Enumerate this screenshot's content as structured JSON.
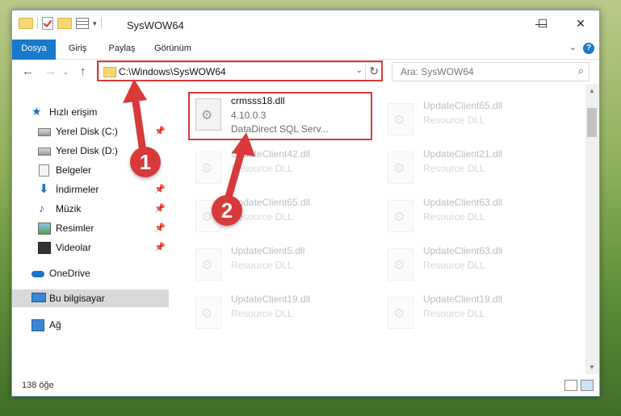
{
  "window": {
    "title": "SysWOW64",
    "controls": {
      "minimize": "—",
      "maximize": "☐",
      "close": "✕"
    }
  },
  "ribbon": {
    "tabs": [
      "Dosya",
      "Giriş",
      "Paylaş",
      "Görünüm"
    ],
    "expand_glyph": "⌄",
    "help_glyph": "?"
  },
  "address": {
    "path": "C:\\Windows\\SysWOW64",
    "back_glyph": "←",
    "forward_glyph": "→",
    "up_glyph": "↑",
    "dropdown_glyph": "⌄",
    "refresh_glyph": "↻"
  },
  "search": {
    "placeholder": "Ara: SysWOW64",
    "icon_glyph": "⌕"
  },
  "nav": {
    "quick_access": "Hızlı erişim",
    "items": [
      {
        "label": "Yerel Disk (C:)",
        "icon": "drive-icon"
      },
      {
        "label": "Yerel Disk (D:)",
        "icon": "drive-icon"
      },
      {
        "label": "Belgeler",
        "icon": "documents-icon"
      },
      {
        "label": "İndirmeler",
        "icon": "downloads-icon"
      },
      {
        "label": "Müzik",
        "icon": "music-icon"
      },
      {
        "label": "Resimler",
        "icon": "pictures-icon"
      },
      {
        "label": "Videolar",
        "icon": "videos-icon"
      }
    ],
    "pin_glyph": "📌",
    "onedrive": "OneDrive",
    "this_pc": "Bu bilgisayar",
    "network": "Ağ"
  },
  "files": {
    "highlighted": {
      "name": "crmsss18.dll",
      "version": "4.10.0.3",
      "description": "DataDirect SQL Serv..."
    },
    "ghost_items": [
      {
        "name": "UpdateClient65.dll",
        "description": "Resource DLL"
      },
      {
        "name": "UpdateClient42.dll",
        "description": "Resource DLL"
      },
      {
        "name": "UpdateClient21.dll",
        "description": "Resource DLL"
      },
      {
        "name": "UpdateClient65.dll",
        "description": "Resource DLL"
      },
      {
        "name": "UpdateClient63.dll",
        "description": "Resource DLL"
      },
      {
        "name": "UpdateClient5.dll",
        "description": "Resource DLL"
      },
      {
        "name": "UpdateClient63.dll",
        "description": "Resource DLL"
      },
      {
        "name": "UpdateClient19.dll",
        "description": "Resource DLL"
      },
      {
        "name": "UpdateClient19.dll",
        "description": "Resource DLL"
      }
    ]
  },
  "status": {
    "item_count": "138 öğe"
  },
  "markers": {
    "one": "1",
    "two": "2"
  },
  "colors": {
    "accent": "#1979ca",
    "annotation": "#d8393a"
  }
}
